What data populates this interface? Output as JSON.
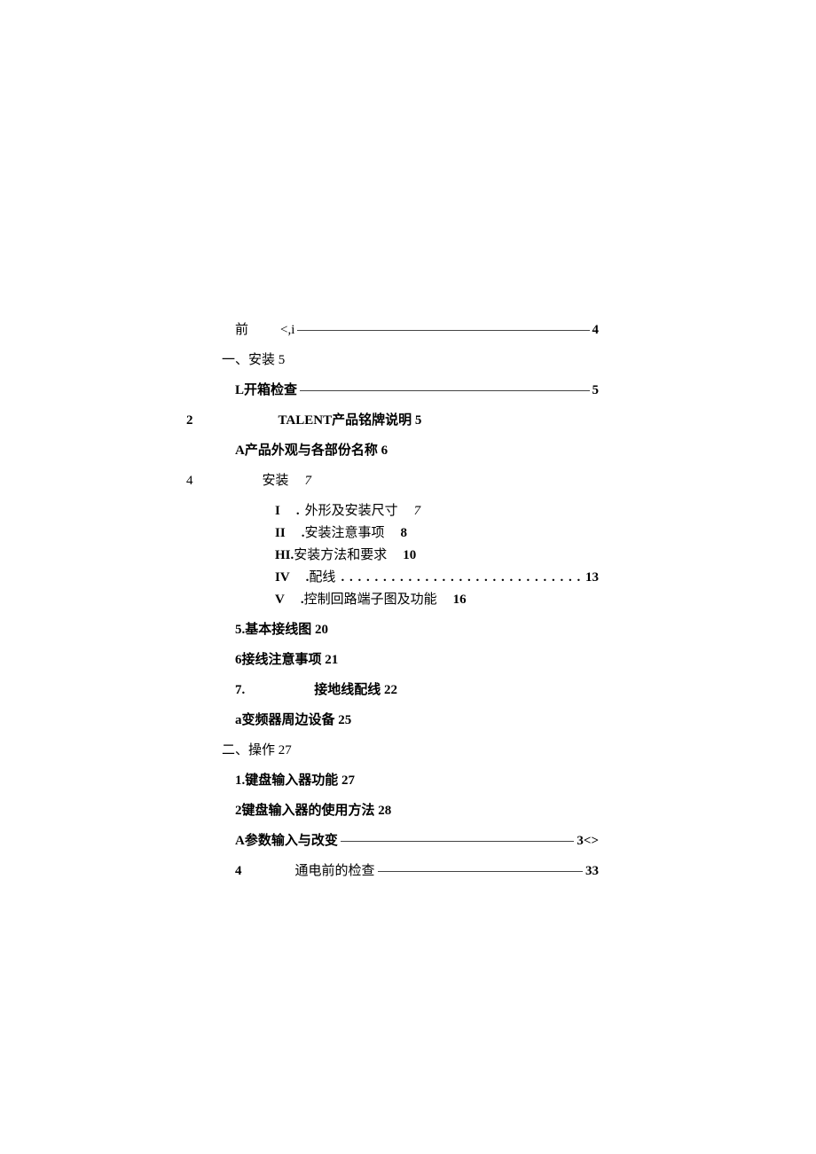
{
  "toc": {
    "line0_left": "前",
    "line0_mid": "<,i",
    "line0_page": "4",
    "line1": "一、安装  5",
    "line2_label": "L开箱检查",
    "line2_page": "5",
    "line3_num": "2",
    "line3_label": "TALENT产品铭牌说明  5",
    "line4": "A产品外观与各部份名称  6",
    "line5_num": "4",
    "line5_label": "安装",
    "line5_page": "7",
    "sub1_roman": "I",
    "sub1_dot": ".",
    "sub1_text": "外形及安装尺寸",
    "sub1_page": "7",
    "sub2_roman": "II",
    "sub2_dot": ".",
    "sub2_text": "安装注意事项",
    "sub2_page": "8",
    "sub3_roman": "HI.",
    "sub3_text": "安装方法和要求",
    "sub3_page": "10",
    "sub4_roman": "IV",
    "sub4_dot": ".",
    "sub4_text": "配线",
    "sub4_dots": ". . . . . . . . . . . . . . . . . . . . . . . . . . . . . . . . . . . . . . . . .",
    "sub4_page": "13",
    "sub5_roman": "V",
    "sub5_dot": ".",
    "sub5_text": "控制回路端子图及功能",
    "sub5_page": "16",
    "line6": "5.基本接线图  20",
    "line7": "6接线注意事项  21",
    "line8_num": "7.",
    "line8_text": "接地线配线  22",
    "line9": "a变频器周边设备  25",
    "line10": "二、操作  27",
    "line11": "1.键盘输入器功能  27",
    "line12": "2键盘输入器的使用方法  28",
    "line13_label": "A参数输入与改变",
    "line13_page": "3<>",
    "line14_num": "4",
    "line14_label": "通电前的检查",
    "line14_page": "33"
  }
}
